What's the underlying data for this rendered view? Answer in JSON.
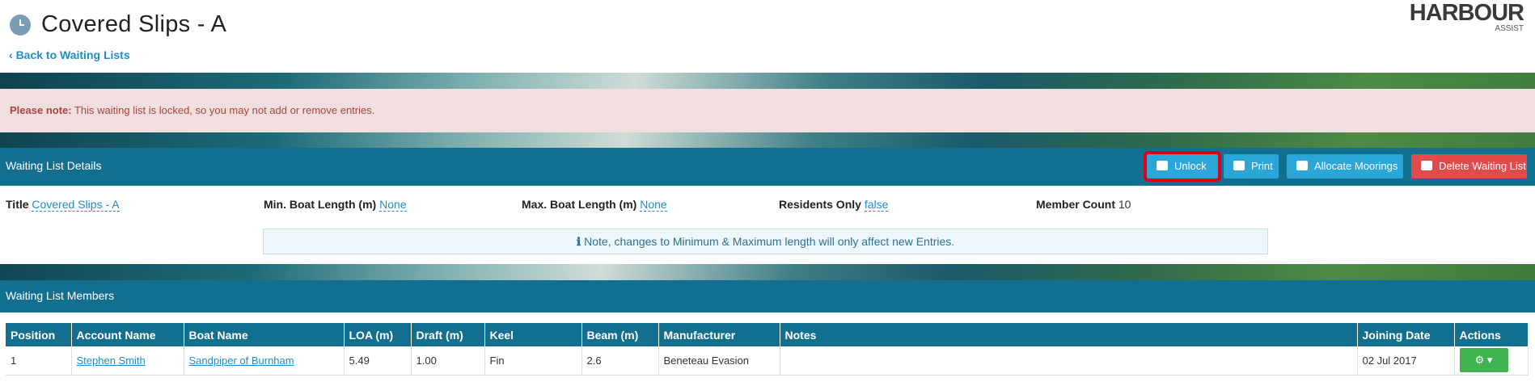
{
  "header": {
    "title": "Covered Slips - A",
    "back_link": "Back to Waiting Lists",
    "logo_main": "HARBOUR",
    "logo_sub": "ASSIST"
  },
  "note": {
    "label": "Please note:",
    "message": " This waiting list is locked, so you may not add or remove entries."
  },
  "details": {
    "heading": "Waiting List Details",
    "buttons": {
      "unlock": "Unlock",
      "print": "Print",
      "allocate": "Allocate Moorings",
      "delete": "Delete Waiting List"
    },
    "fields": {
      "title_label": "Title",
      "title_value": "Covered Slips - A",
      "min_label": "Min. Boat Length (m)",
      "min_value": "None",
      "max_label": "Max. Boat Length (m)",
      "max_value": "None",
      "residents_label": "Residents Only",
      "residents_value": "false",
      "count_label": "Member Count",
      "count_value": "10"
    },
    "info": "Note, changes to Minimum & Maximum length will only affect new Entries."
  },
  "members": {
    "heading": "Waiting List Members",
    "columns": [
      "Position",
      "Account Name",
      "Boat Name",
      "LOA (m)",
      "Draft (m)",
      "Keel",
      "Beam (m)",
      "Manufacturer",
      "Notes",
      "Joining Date",
      "Actions"
    ],
    "rows": [
      {
        "position": "1",
        "account": "Stephen Smith",
        "boat": "Sandpiper of Burnham",
        "loa": "5.49",
        "draft": "1.00",
        "keel": "Fin",
        "beam": "2.6",
        "manufacturer": "Beneteau Evasion",
        "notes": "",
        "joining_date": "02 Jul 2017"
      }
    ]
  },
  "icons": {
    "title_icon": "clock-icon",
    "back_icon": "chevron-left-icon",
    "unlock_icon": "unlock-icon",
    "print_icon": "print-icon",
    "allocate_icon": "compress-icon",
    "delete_icon": "trash-icon",
    "info_icon": "info-icon",
    "actions_icon": "gears-icon"
  },
  "colors": {
    "panel": "#136f90",
    "accent": "#2aa6d9",
    "danger": "#e14b4b",
    "success": "#3fb34f",
    "highlight": "#d9001b"
  }
}
